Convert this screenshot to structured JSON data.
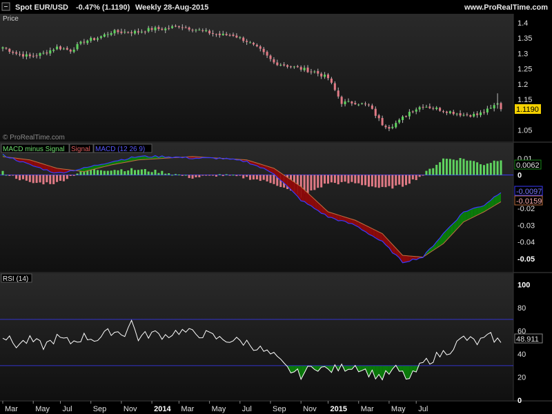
{
  "header": {
    "symbol": "Spot EUR/USD",
    "change": "-0.47% (1.1190)",
    "period": "Weekly",
    "date": "28-Aug-2015",
    "site": "www.ProRealTime.com"
  },
  "watermark": "© ProRealTime.com",
  "colors": {
    "up": "#5fd35f",
    "down": "#e07a85",
    "macd": "#3a3aff",
    "signal": "#c07040",
    "green_fill": "#0a7a0a",
    "red_fill": "#8a0a0a",
    "rsi_line": "#ffffff",
    "guide": "#3333cc",
    "last_price_bg": "#f4d000"
  },
  "chart_data": [
    {
      "type": "candlestick",
      "panel_label": "Price",
      "ylim": [
        1.02,
        1.42
      ],
      "yticks": [
        "1.4",
        "1.35",
        "1.3",
        "1.25",
        "1.2",
        "1.15",
        "1.05"
      ],
      "last_value_label": "1.1190",
      "close_anchors": [
        [
          0,
          1.32
        ],
        [
          4,
          1.3
        ],
        [
          8,
          1.29
        ],
        [
          12,
          1.3
        ],
        [
          16,
          1.32
        ],
        [
          20,
          1.31
        ],
        [
          24,
          1.34
        ],
        [
          28,
          1.35
        ],
        [
          32,
          1.37
        ],
        [
          36,
          1.37
        ],
        [
          40,
          1.37
        ],
        [
          44,
          1.38
        ],
        [
          48,
          1.38
        ],
        [
          52,
          1.39
        ],
        [
          56,
          1.38
        ],
        [
          60,
          1.37
        ],
        [
          64,
          1.36
        ],
        [
          68,
          1.36
        ],
        [
          72,
          1.34
        ],
        [
          76,
          1.31
        ],
        [
          80,
          1.27
        ],
        [
          84,
          1.26
        ],
        [
          88,
          1.25
        ],
        [
          92,
          1.24
        ],
        [
          96,
          1.22
        ],
        [
          98,
          1.18
        ],
        [
          100,
          1.14
        ],
        [
          104,
          1.14
        ],
        [
          108,
          1.13
        ],
        [
          112,
          1.07
        ],
        [
          114,
          1.06
        ],
        [
          117,
          1.08
        ],
        [
          120,
          1.11
        ],
        [
          124,
          1.13
        ],
        [
          128,
          1.12
        ],
        [
          132,
          1.11
        ],
        [
          136,
          1.1
        ],
        [
          140,
          1.1
        ],
        [
          142,
          1.11
        ],
        [
          144,
          1.12
        ],
        [
          146,
          1.14
        ],
        [
          147,
          1.12
        ]
      ]
    },
    {
      "type": "macd",
      "legend": [
        "MACD minus Signal",
        "Signal",
        "MACD (12 26 9)"
      ],
      "ylim": [
        -0.057,
        0.013
      ],
      "yticks": [
        "0.01",
        "0",
        "-0.01",
        "-0.02",
        "-0.03",
        "-0.04",
        "-0.05"
      ],
      "labels": {
        "hist": "0.0062",
        "macd": "-0.0097",
        "signal": "-0.0159"
      },
      "macd_anchors": [
        [
          0,
          0.012
        ],
        [
          8,
          0.006
        ],
        [
          16,
          0.001
        ],
        [
          24,
          0.004
        ],
        [
          32,
          0.008
        ],
        [
          40,
          0.011
        ],
        [
          48,
          0.011
        ],
        [
          56,
          0.01
        ],
        [
          64,
          0.01
        ],
        [
          72,
          0.008
        ],
        [
          80,
          0.001
        ],
        [
          88,
          -0.015
        ],
        [
          96,
          -0.025
        ],
        [
          104,
          -0.03
        ],
        [
          112,
          -0.04
        ],
        [
          118,
          -0.052
        ],
        [
          124,
          -0.049
        ],
        [
          130,
          -0.035
        ],
        [
          136,
          -0.022
        ],
        [
          142,
          -0.018
        ],
        [
          147,
          -0.01
        ]
      ],
      "signal_anchors": [
        [
          0,
          0.011
        ],
        [
          8,
          0.009
        ],
        [
          16,
          0.004
        ],
        [
          24,
          0.002
        ],
        [
          32,
          0.006
        ],
        [
          40,
          0.009
        ],
        [
          48,
          0.01
        ],
        [
          56,
          0.011
        ],
        [
          64,
          0.01
        ],
        [
          72,
          0.009
        ],
        [
          80,
          0.004
        ],
        [
          88,
          -0.007
        ],
        [
          96,
          -0.022
        ],
        [
          104,
          -0.027
        ],
        [
          112,
          -0.035
        ],
        [
          118,
          -0.048
        ],
        [
          124,
          -0.049
        ],
        [
          130,
          -0.041
        ],
        [
          136,
          -0.028
        ],
        [
          142,
          -0.022
        ],
        [
          147,
          -0.016
        ]
      ]
    },
    {
      "type": "line",
      "panel_label": "RSI (14)",
      "ylim": [
        0,
        110
      ],
      "yticks": [
        "100",
        "80",
        "60",
        "40",
        "20",
        "0"
      ],
      "guides": [
        70,
        30
      ],
      "last_value_label": "48.911",
      "rsi_anchors": [
        [
          0,
          56
        ],
        [
          4,
          48
        ],
        [
          8,
          52
        ],
        [
          12,
          47
        ],
        [
          16,
          54
        ],
        [
          20,
          50
        ],
        [
          24,
          55
        ],
        [
          28,
          53
        ],
        [
          32,
          60
        ],
        [
          36,
          58
        ],
        [
          38,
          68
        ],
        [
          40,
          54
        ],
        [
          44,
          58
        ],
        [
          48,
          56
        ],
        [
          52,
          60
        ],
        [
          56,
          58
        ],
        [
          60,
          57
        ],
        [
          64,
          53
        ],
        [
          68,
          52
        ],
        [
          72,
          50
        ],
        [
          76,
          44
        ],
        [
          80,
          38
        ],
        [
          84,
          27
        ],
        [
          88,
          22
        ],
        [
          92,
          30
        ],
        [
          96,
          26
        ],
        [
          100,
          28
        ],
        [
          104,
          30
        ],
        [
          108,
          24
        ],
        [
          112,
          20
        ],
        [
          116,
          27
        ],
        [
          120,
          18
        ],
        [
          124,
          32
        ],
        [
          128,
          38
        ],
        [
          132,
          44
        ],
        [
          136,
          54
        ],
        [
          140,
          50
        ],
        [
          144,
          55
        ],
        [
          146,
          52
        ],
        [
          147,
          48
        ]
      ]
    }
  ],
  "x_axis": {
    "labels": [
      {
        "text": "Mar",
        "w": 0,
        "bold": false
      },
      {
        "text": "May",
        "w": 9,
        "bold": false
      },
      {
        "text": "Jul",
        "w": 17,
        "bold": false
      },
      {
        "text": "Sep",
        "w": 26,
        "bold": false
      },
      {
        "text": "Nov",
        "w": 35,
        "bold": false
      },
      {
        "text": "2014",
        "w": 44,
        "bold": true
      },
      {
        "text": "Mar",
        "w": 52,
        "bold": false
      },
      {
        "text": "May",
        "w": 61,
        "bold": false
      },
      {
        "text": "Jul",
        "w": 70,
        "bold": false
      },
      {
        "text": "Sep",
        "w": 79,
        "bold": false
      },
      {
        "text": "Nov",
        "w": 88,
        "bold": false
      },
      {
        "text": "2015",
        "w": 96,
        "bold": true
      },
      {
        "text": "Mar",
        "w": 105,
        "bold": false
      },
      {
        "text": "May",
        "w": 114,
        "bold": false
      },
      {
        "text": "Jul",
        "w": 122,
        "bold": false
      }
    ]
  }
}
